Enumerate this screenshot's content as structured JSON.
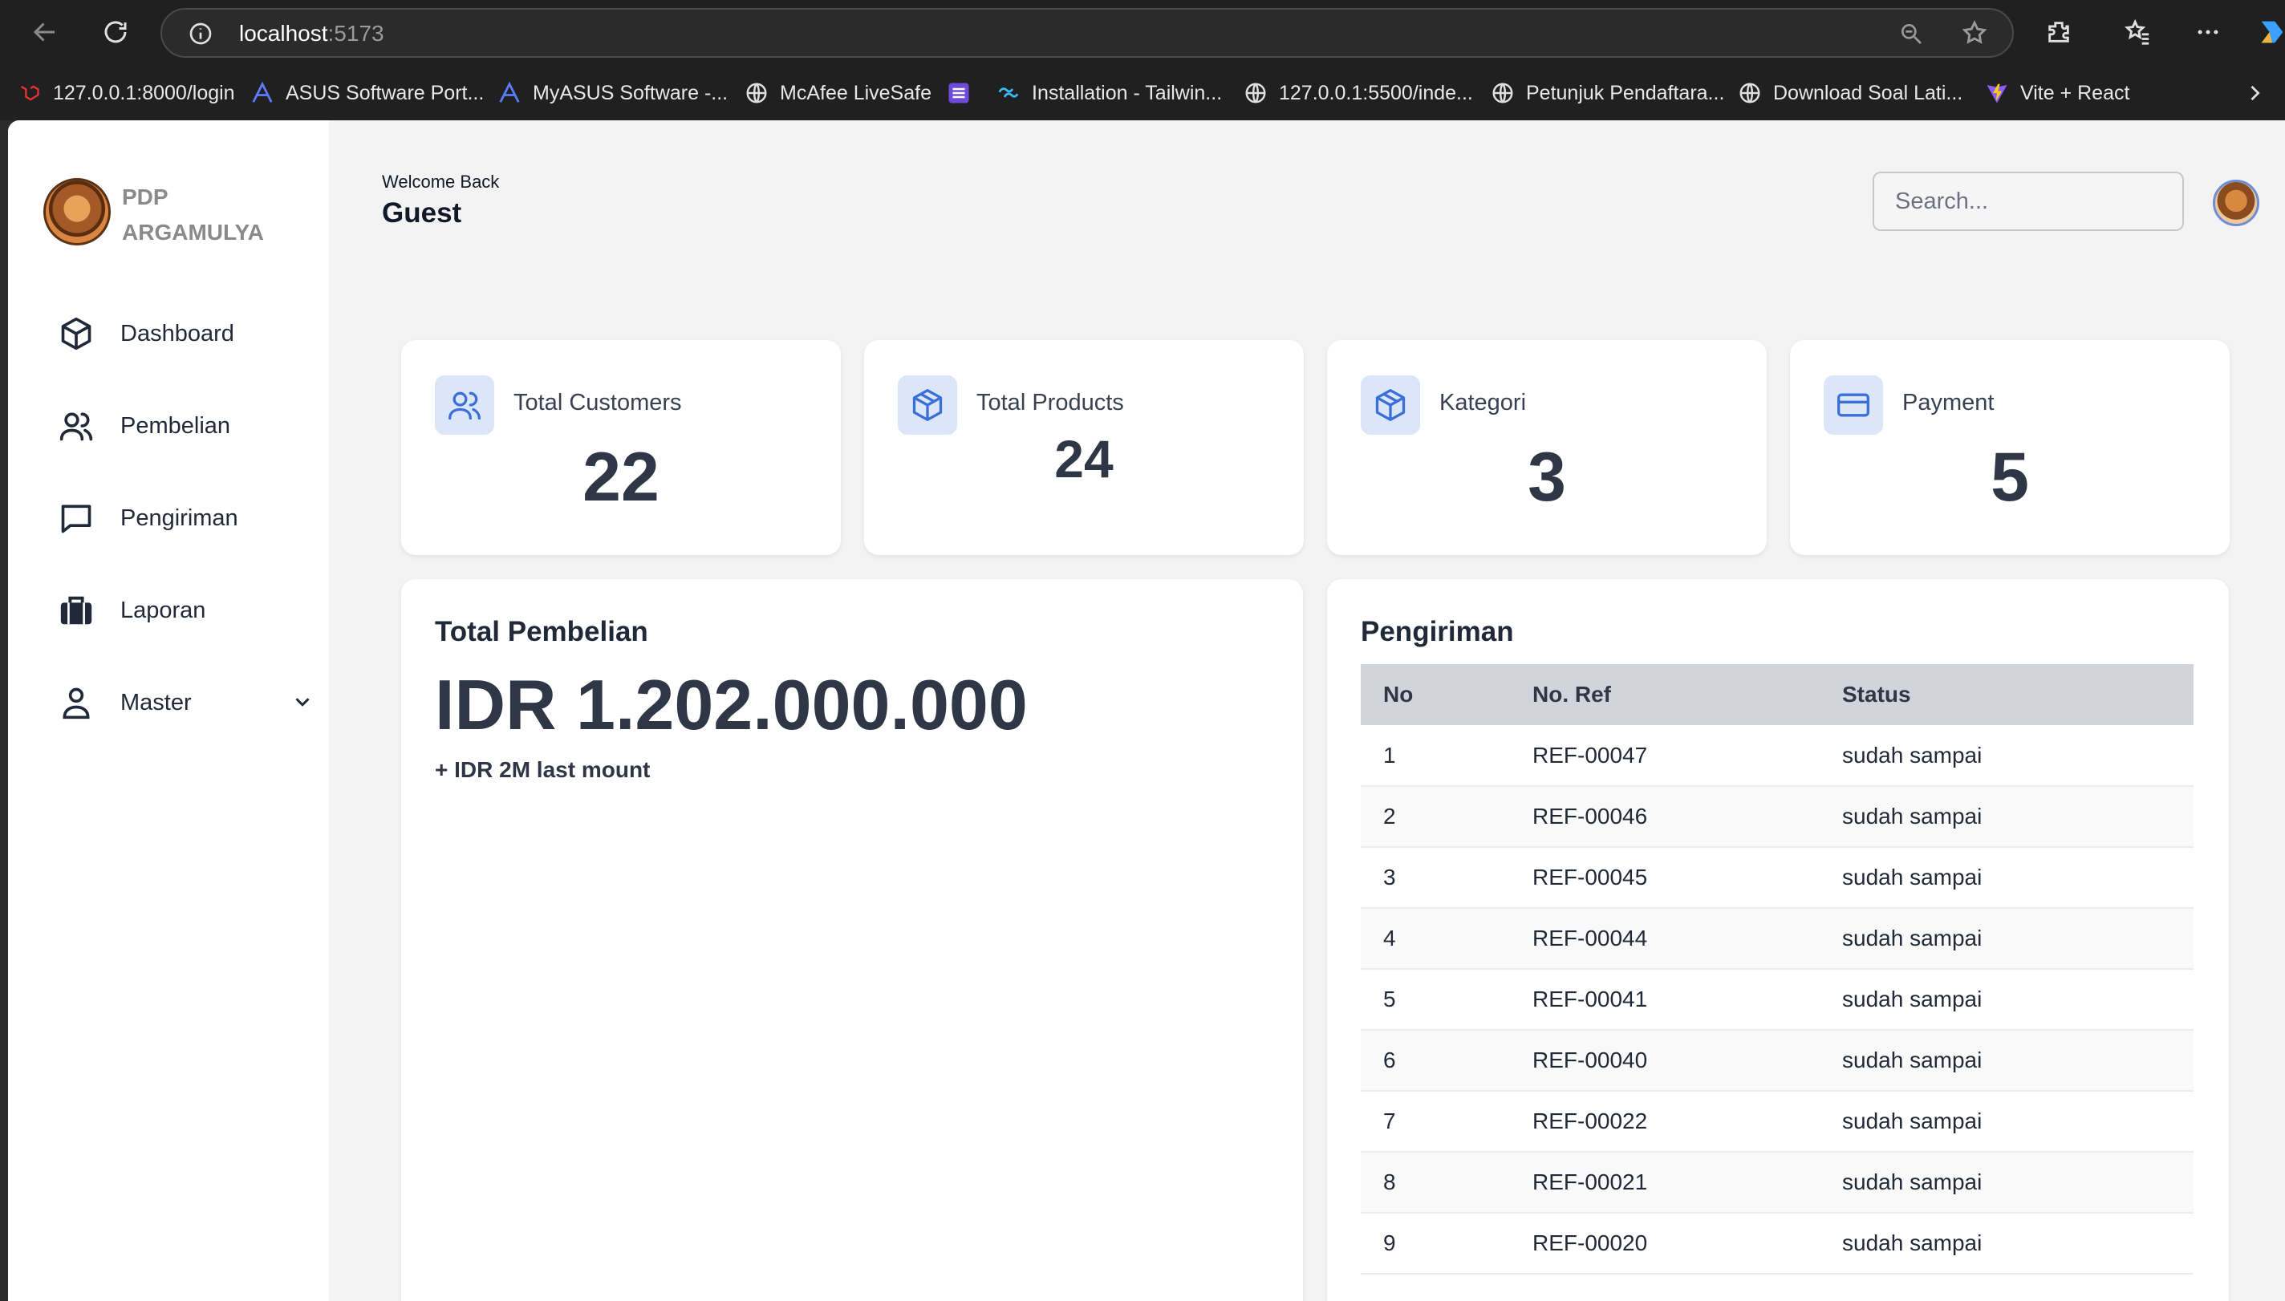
{
  "browser": {
    "url_host": "localhost",
    "url_port": ":5173",
    "bookmarks": [
      {
        "label": "127.0.0.1:8000/login",
        "icon": "laravel-icon",
        "color": "#e3342f"
      },
      {
        "label": "ASUS Software Port...",
        "icon": "asus-icon",
        "color": "#5c7cfa"
      },
      {
        "label": "MyASUS Software -...",
        "icon": "asus-icon",
        "color": "#5c7cfa"
      },
      {
        "label": "McAfee LiveSafe",
        "icon": "globe-icon",
        "color": "#e8e8e8"
      },
      {
        "label": "",
        "icon": "list-icon",
        "color": "#8b5cf6"
      },
      {
        "label": "Installation - Tailwin...",
        "icon": "tailwind-icon",
        "color": "#38bdf8"
      },
      {
        "label": "127.0.0.1:5500/inde...",
        "icon": "globe-icon",
        "color": "#e8e8e8"
      },
      {
        "label": "Petunjuk Pendaftara...",
        "icon": "globe-icon",
        "color": "#e8e8e8"
      },
      {
        "label": "Download Soal Lati...",
        "icon": "globe-icon",
        "color": "#e8e8e8"
      },
      {
        "label": "Vite + React",
        "icon": "vite-icon",
        "color": "#a855f7"
      }
    ]
  },
  "sidebar": {
    "brand_line1": "PDP",
    "brand_line2": "ARGAMULYA",
    "items": [
      {
        "label": "Dashboard",
        "icon": "cube-icon"
      },
      {
        "label": "Pembelian",
        "icon": "users-icon"
      },
      {
        "label": "Pengiriman",
        "icon": "message-icon"
      },
      {
        "label": "Laporan",
        "icon": "briefcase-icon"
      },
      {
        "label": "Master",
        "icon": "user-icon"
      }
    ]
  },
  "header": {
    "welcome": "Welcome Back",
    "user": "Guest",
    "search_placeholder": "Search..."
  },
  "stats": [
    {
      "label": "Total Customers",
      "value": "22",
      "icon": "users-icon"
    },
    {
      "label": "Total Products",
      "value": "24",
      "icon": "cube-icon"
    },
    {
      "label": "Kategori",
      "value": "3",
      "icon": "cube-icon"
    },
    {
      "label": "Payment",
      "value": "5",
      "icon": "credit-card-icon"
    }
  ],
  "pembelian": {
    "title": "Total Pembelian",
    "total": "IDR 1.202.000.000",
    "sub": "+ IDR 2M last mount"
  },
  "pengiriman": {
    "title": "Pengiriman",
    "headers": [
      "No",
      "No. Ref",
      "Status"
    ],
    "rows": [
      [
        "1",
        "REF-00047",
        "sudah sampai"
      ],
      [
        "2",
        "REF-00046",
        "sudah sampai"
      ],
      [
        "3",
        "REF-00045",
        "sudah sampai"
      ],
      [
        "4",
        "REF-00044",
        "sudah sampai"
      ],
      [
        "5",
        "REF-00041",
        "sudah sampai"
      ],
      [
        "6",
        "REF-00040",
        "sudah sampai"
      ],
      [
        "7",
        "REF-00022",
        "sudah sampai"
      ],
      [
        "8",
        "REF-00021",
        "sudah sampai"
      ],
      [
        "9",
        "REF-00020",
        "sudah sampai"
      ]
    ]
  },
  "colors": {
    "accent": "#3b6fd8",
    "icon_bg": "#dbe6fb",
    "text_dark": "#2f3747"
  }
}
